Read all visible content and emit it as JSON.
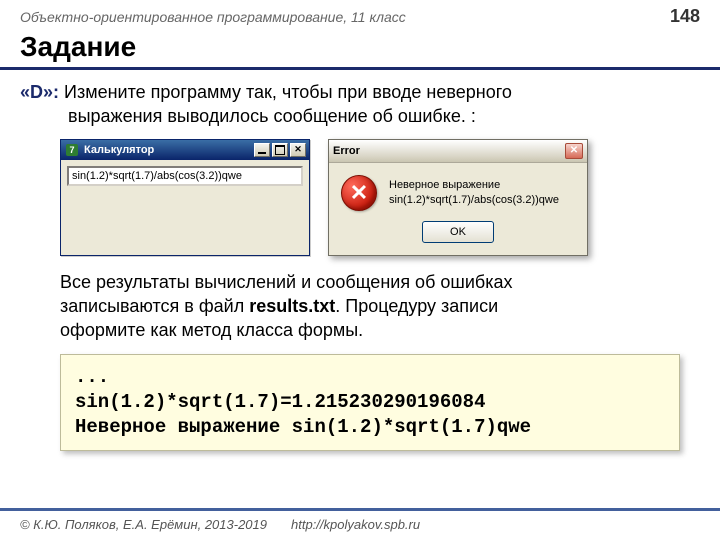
{
  "header": {
    "course": "Объектно-ориентированное программирование, 11 класс",
    "page": "148"
  },
  "title": "Задание",
  "task": {
    "label": "«D»:",
    "line1a": " Измените программу так, чтобы при вводе неверного",
    "line1b": "выражения выводилось сообщение об ошибке. :"
  },
  "calc": {
    "title": "Калькулятор",
    "input": "sin(1.2)*sqrt(1.7)/abs(cos(3.2))qwe"
  },
  "error": {
    "title": "Error",
    "msg1": "Неверное выражение",
    "msg2": "sin(1.2)*sqrt(1.7)/abs(cos(3.2))qwe",
    "ok": "OK"
  },
  "para": {
    "l1": "Все результаты вычислений и сообщения об ошибках",
    "l2a": "записываются в файл ",
    "l2b": "results.txt",
    "l2c": ". Процедуру записи",
    "l3": "оформите как метод класса формы."
  },
  "code": {
    "l1": "...",
    "l2": "sin(1.2)*sqrt(1.7)=1.215230290196084",
    "l3": "Неверное выражение sin(1.2)*sqrt(1.7)qwe"
  },
  "footer": {
    "copyright": "© К.Ю. Поляков, Е.А. Ерёмин, 2013-2019",
    "url": "http://kpolyakov.spb.ru"
  }
}
